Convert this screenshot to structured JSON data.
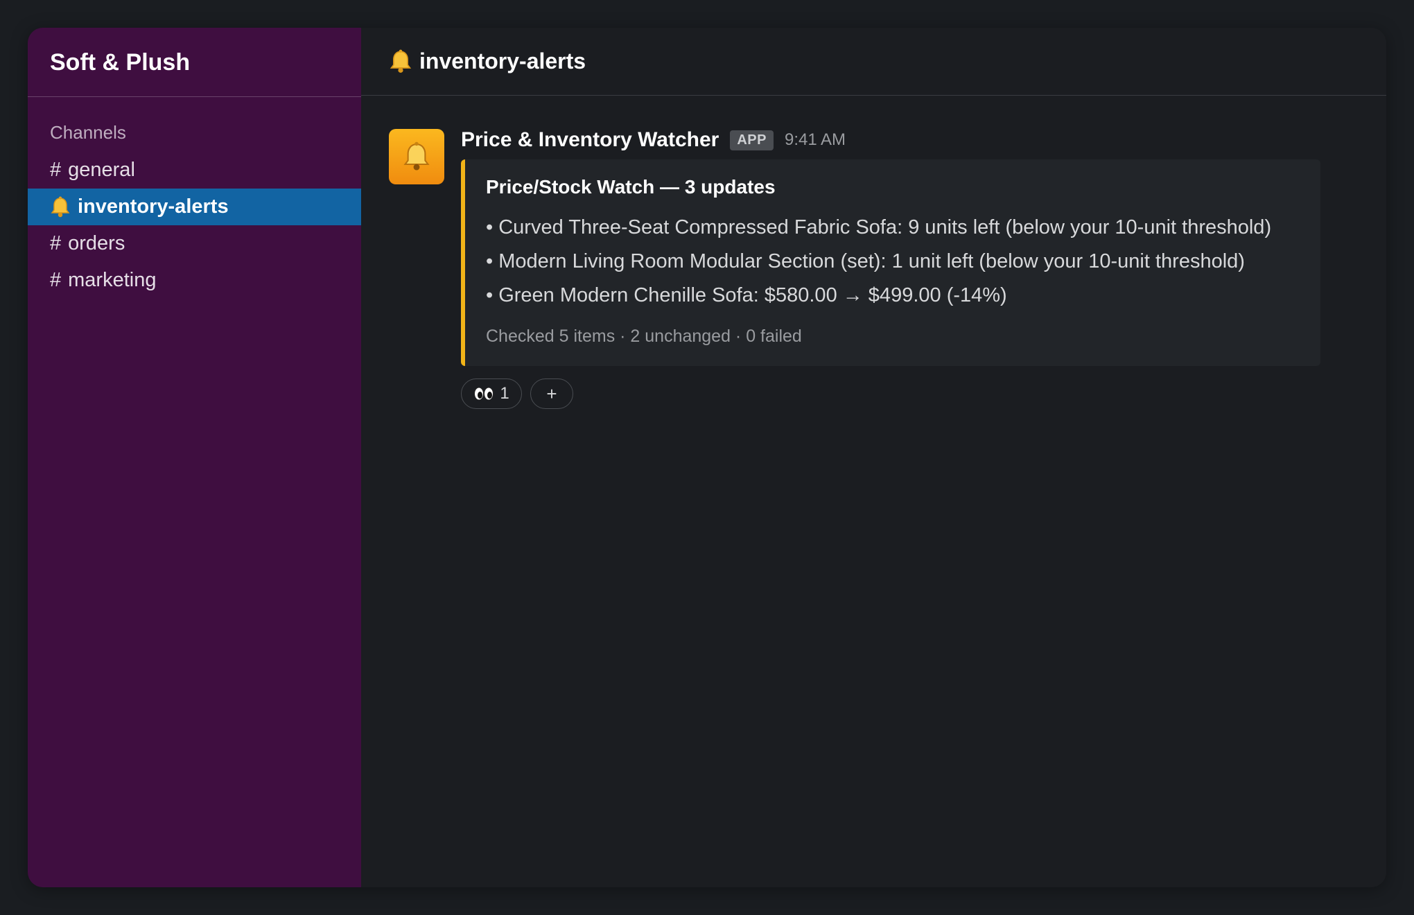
{
  "workspace": {
    "name": "Soft & Plush"
  },
  "sidebar": {
    "section_label": "Channels",
    "channels": [
      {
        "prefix": "#",
        "label": "general",
        "active": false
      },
      {
        "prefix": "bell-icon",
        "label": "inventory-alerts",
        "active": true
      },
      {
        "prefix": "#",
        "label": "orders",
        "active": false
      },
      {
        "prefix": "#",
        "label": "marketing",
        "active": false
      }
    ]
  },
  "header": {
    "icon": "bell-icon",
    "title": "inventory-alerts"
  },
  "message": {
    "sender": "Price & Inventory Watcher",
    "badge": "APP",
    "time": "9:41 AM",
    "avatar_icon": "bell-icon",
    "attachment": {
      "accent_color": "#f2b418",
      "title": "Price/Stock Watch — 3 updates",
      "items": [
        "• Curved Three-Seat Compressed Fabric Sofa: 9 units left (below your 10-unit threshold)",
        "• Modern Living Room Modular Section (set): 1 unit left (below your 10-unit threshold)",
        "• Green Modern Chenille Sofa: $580.00 → $499.00 (-14%)"
      ],
      "footer": "Checked 5 items · 2 unchanged · 0 failed"
    },
    "reactions": [
      {
        "emoji": "eyes-icon",
        "count": "1"
      }
    ],
    "add_reaction_label": "+"
  },
  "colors": {
    "sidebar_bg": "#3f0e40",
    "active_channel": "#1264a3",
    "main_bg": "#1b1d21",
    "accent": "#f2b418"
  }
}
